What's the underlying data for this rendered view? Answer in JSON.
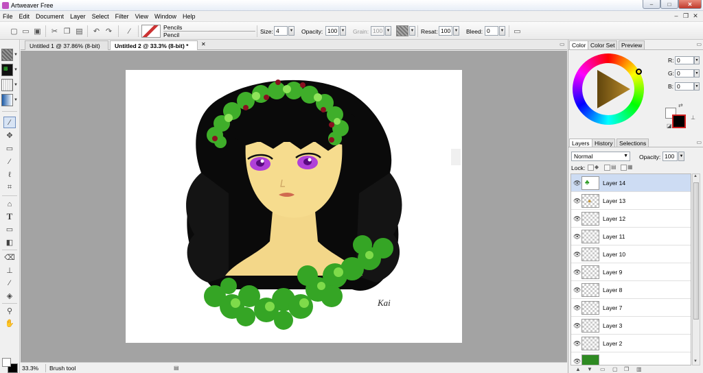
{
  "window": {
    "title": "Artweaver Free",
    "minimize": "–",
    "maximize": "□",
    "close": "✕"
  },
  "menu": [
    "File",
    "Edit",
    "Document",
    "Layer",
    "Select",
    "Filter",
    "View",
    "Window",
    "Help"
  ],
  "toolbar": {
    "brush_category": "Pencils",
    "brush_variant": "Pencil",
    "size_label": "Size:",
    "size_value": "4",
    "opacity_label": "Opacity:",
    "opacity_value": "100",
    "grain_label": "Grain:",
    "grain_value": "100",
    "resat_label": "Resat:",
    "resat_value": "100",
    "bleed_label": "Bleed:",
    "bleed_value": "0"
  },
  "documents": [
    {
      "label": "Untitled 1 @ 37.86% (8-bit)"
    },
    {
      "label": "Untitled 2 @ 33.3% (8-bit) *"
    }
  ],
  "status": {
    "zoom": "33.3%",
    "tool": "Brush tool"
  },
  "color_panel": {
    "tabs": [
      "Color",
      "Color Set",
      "Preview"
    ],
    "r_label": "R:",
    "r": "0",
    "g_label": "G:",
    "g": "0",
    "b_label": "B:",
    "b": "0",
    "foreground": "#ffffff",
    "background": "#000000"
  },
  "layers_panel": {
    "tabs": [
      "Layers",
      "History",
      "Selections"
    ],
    "blend_mode": "Normal",
    "opacity_label": "Opacity:",
    "opacity": "100",
    "lock_label": "Lock:",
    "layers": [
      {
        "name": "Layer 14"
      },
      {
        "name": "Layer 13"
      },
      {
        "name": "Layer 12"
      },
      {
        "name": "Layer 11"
      },
      {
        "name": "Layer 10"
      },
      {
        "name": "Layer 9"
      },
      {
        "name": "Layer 8"
      },
      {
        "name": "Layer 7"
      },
      {
        "name": "Layer 3"
      },
      {
        "name": "Layer 2"
      }
    ]
  },
  "signature": "Kai",
  "colors": {
    "accent": "#cddcf3",
    "hair": "#0a0a0a",
    "clover": "#3fae2a",
    "skin": "#f6dc8e",
    "eyes": "#b040d8"
  }
}
